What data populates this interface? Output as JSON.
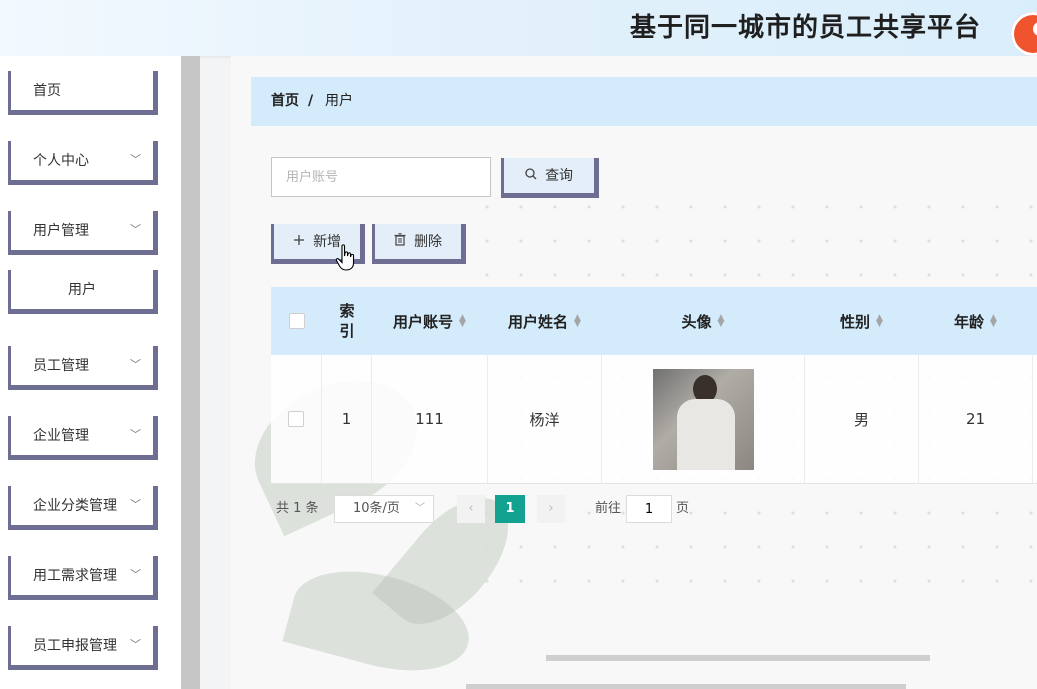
{
  "header": {
    "title": "基于同一城市的员工共享平台",
    "logo_icon": "logo-icon"
  },
  "sidebar": {
    "items": [
      {
        "label": "首页",
        "has_children": false
      },
      {
        "label": "个人中心",
        "has_children": true
      },
      {
        "label": "用户管理",
        "has_children": true
      },
      {
        "label": "用户",
        "has_children": false,
        "sub": true
      },
      {
        "label": "员工管理",
        "has_children": true
      },
      {
        "label": "企业管理",
        "has_children": true
      },
      {
        "label": "企业分类管理",
        "has_children": true
      },
      {
        "label": "用工需求管理",
        "has_children": true
      },
      {
        "label": "员工申报管理",
        "has_children": true
      }
    ],
    "chevron": "﹀"
  },
  "breadcrumb": {
    "home": "首页",
    "separator": "/",
    "current": "用户"
  },
  "search": {
    "placeholder": "用户账号",
    "value": "",
    "button_label": "查询",
    "button_icon": "search-icon"
  },
  "toolbar": {
    "add_label": "新增",
    "add_icon": "plus-icon",
    "delete_label": "删除",
    "delete_icon": "trash-icon"
  },
  "table": {
    "columns": [
      "索引",
      "用户账号",
      "用户姓名",
      "头像",
      "性别",
      "年龄"
    ],
    "rows": [
      {
        "index": "1",
        "account": "111",
        "name": "杨洋",
        "avatar": "avatar-photo",
        "gender": "男",
        "age": "21"
      }
    ]
  },
  "pagination": {
    "total": "共 1 条",
    "page_size": "10条/页",
    "current_page": "1",
    "goto_label": "前往",
    "goto_value": "1",
    "goto_unit": "页"
  },
  "colors": {
    "accent": "#13a28f",
    "header_bg": "#d3ebfb",
    "menu_border": "#6e6d92"
  }
}
